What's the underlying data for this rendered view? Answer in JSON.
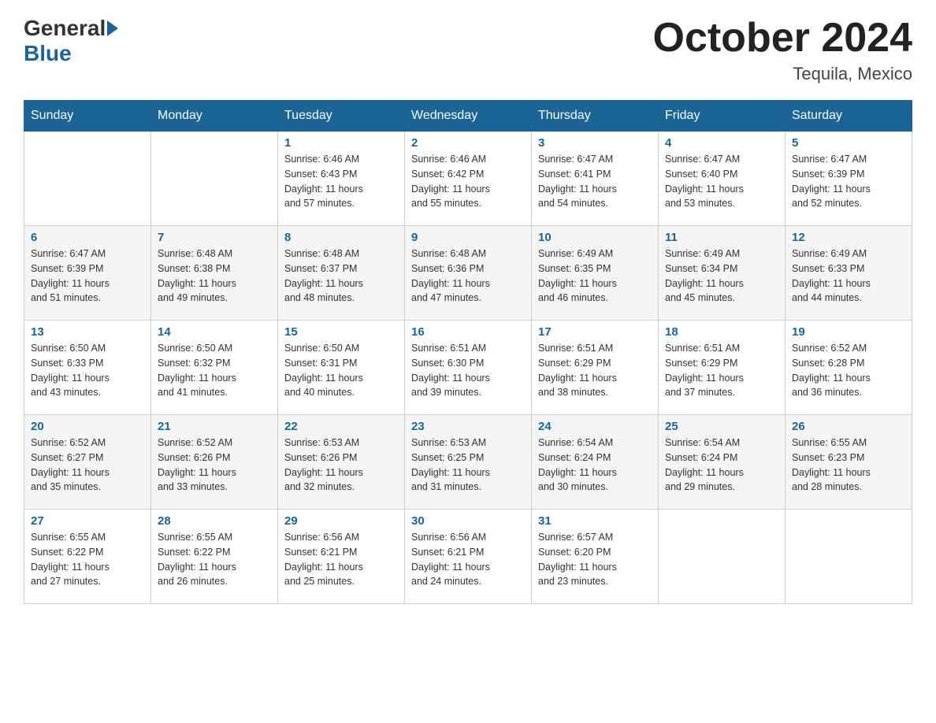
{
  "header": {
    "logo_general": "General",
    "logo_blue": "Blue",
    "month": "October 2024",
    "location": "Tequila, Mexico"
  },
  "days_of_week": [
    "Sunday",
    "Monday",
    "Tuesday",
    "Wednesday",
    "Thursday",
    "Friday",
    "Saturday"
  ],
  "weeks": [
    [
      {
        "day": "",
        "info": ""
      },
      {
        "day": "",
        "info": ""
      },
      {
        "day": "1",
        "info": "Sunrise: 6:46 AM\nSunset: 6:43 PM\nDaylight: 11 hours\nand 57 minutes."
      },
      {
        "day": "2",
        "info": "Sunrise: 6:46 AM\nSunset: 6:42 PM\nDaylight: 11 hours\nand 55 minutes."
      },
      {
        "day": "3",
        "info": "Sunrise: 6:47 AM\nSunset: 6:41 PM\nDaylight: 11 hours\nand 54 minutes."
      },
      {
        "day": "4",
        "info": "Sunrise: 6:47 AM\nSunset: 6:40 PM\nDaylight: 11 hours\nand 53 minutes."
      },
      {
        "day": "5",
        "info": "Sunrise: 6:47 AM\nSunset: 6:39 PM\nDaylight: 11 hours\nand 52 minutes."
      }
    ],
    [
      {
        "day": "6",
        "info": "Sunrise: 6:47 AM\nSunset: 6:39 PM\nDaylight: 11 hours\nand 51 minutes."
      },
      {
        "day": "7",
        "info": "Sunrise: 6:48 AM\nSunset: 6:38 PM\nDaylight: 11 hours\nand 49 minutes."
      },
      {
        "day": "8",
        "info": "Sunrise: 6:48 AM\nSunset: 6:37 PM\nDaylight: 11 hours\nand 48 minutes."
      },
      {
        "day": "9",
        "info": "Sunrise: 6:48 AM\nSunset: 6:36 PM\nDaylight: 11 hours\nand 47 minutes."
      },
      {
        "day": "10",
        "info": "Sunrise: 6:49 AM\nSunset: 6:35 PM\nDaylight: 11 hours\nand 46 minutes."
      },
      {
        "day": "11",
        "info": "Sunrise: 6:49 AM\nSunset: 6:34 PM\nDaylight: 11 hours\nand 45 minutes."
      },
      {
        "day": "12",
        "info": "Sunrise: 6:49 AM\nSunset: 6:33 PM\nDaylight: 11 hours\nand 44 minutes."
      }
    ],
    [
      {
        "day": "13",
        "info": "Sunrise: 6:50 AM\nSunset: 6:33 PM\nDaylight: 11 hours\nand 43 minutes."
      },
      {
        "day": "14",
        "info": "Sunrise: 6:50 AM\nSunset: 6:32 PM\nDaylight: 11 hours\nand 41 minutes."
      },
      {
        "day": "15",
        "info": "Sunrise: 6:50 AM\nSunset: 6:31 PM\nDaylight: 11 hours\nand 40 minutes."
      },
      {
        "day": "16",
        "info": "Sunrise: 6:51 AM\nSunset: 6:30 PM\nDaylight: 11 hours\nand 39 minutes."
      },
      {
        "day": "17",
        "info": "Sunrise: 6:51 AM\nSunset: 6:29 PM\nDaylight: 11 hours\nand 38 minutes."
      },
      {
        "day": "18",
        "info": "Sunrise: 6:51 AM\nSunset: 6:29 PM\nDaylight: 11 hours\nand 37 minutes."
      },
      {
        "day": "19",
        "info": "Sunrise: 6:52 AM\nSunset: 6:28 PM\nDaylight: 11 hours\nand 36 minutes."
      }
    ],
    [
      {
        "day": "20",
        "info": "Sunrise: 6:52 AM\nSunset: 6:27 PM\nDaylight: 11 hours\nand 35 minutes."
      },
      {
        "day": "21",
        "info": "Sunrise: 6:52 AM\nSunset: 6:26 PM\nDaylight: 11 hours\nand 33 minutes."
      },
      {
        "day": "22",
        "info": "Sunrise: 6:53 AM\nSunset: 6:26 PM\nDaylight: 11 hours\nand 32 minutes."
      },
      {
        "day": "23",
        "info": "Sunrise: 6:53 AM\nSunset: 6:25 PM\nDaylight: 11 hours\nand 31 minutes."
      },
      {
        "day": "24",
        "info": "Sunrise: 6:54 AM\nSunset: 6:24 PM\nDaylight: 11 hours\nand 30 minutes."
      },
      {
        "day": "25",
        "info": "Sunrise: 6:54 AM\nSunset: 6:24 PM\nDaylight: 11 hours\nand 29 minutes."
      },
      {
        "day": "26",
        "info": "Sunrise: 6:55 AM\nSunset: 6:23 PM\nDaylight: 11 hours\nand 28 minutes."
      }
    ],
    [
      {
        "day": "27",
        "info": "Sunrise: 6:55 AM\nSunset: 6:22 PM\nDaylight: 11 hours\nand 27 minutes."
      },
      {
        "day": "28",
        "info": "Sunrise: 6:55 AM\nSunset: 6:22 PM\nDaylight: 11 hours\nand 26 minutes."
      },
      {
        "day": "29",
        "info": "Sunrise: 6:56 AM\nSunset: 6:21 PM\nDaylight: 11 hours\nand 25 minutes."
      },
      {
        "day": "30",
        "info": "Sunrise: 6:56 AM\nSunset: 6:21 PM\nDaylight: 11 hours\nand 24 minutes."
      },
      {
        "day": "31",
        "info": "Sunrise: 6:57 AM\nSunset: 6:20 PM\nDaylight: 11 hours\nand 23 minutes."
      },
      {
        "day": "",
        "info": ""
      },
      {
        "day": "",
        "info": ""
      }
    ]
  ]
}
